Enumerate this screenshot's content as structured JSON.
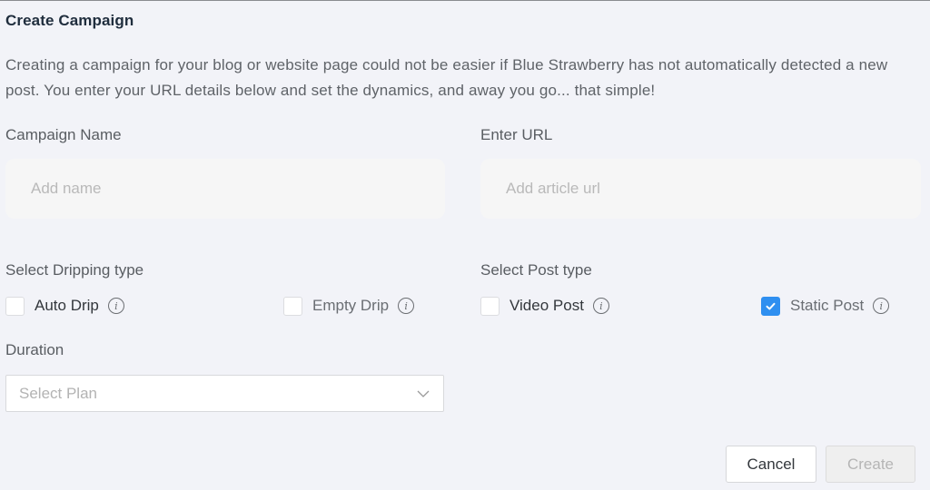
{
  "dialog": {
    "title": "Create Campaign",
    "description": "Creating a campaign for your blog or website page could not be easier if Blue Strawberry has not automatically detected a new post. You enter your URL details below and set the dynamics, and away you go... that simple!"
  },
  "campaign_name": {
    "label": "Campaign Name",
    "value": "",
    "placeholder": "Add name"
  },
  "url": {
    "label": "Enter URL",
    "value": "",
    "placeholder": "Add article url"
  },
  "dripping_type": {
    "label": "Select Dripping type",
    "options": [
      {
        "label": "Auto Drip",
        "checked": false,
        "icon": "info-icon"
      },
      {
        "label": "Empty Drip",
        "checked": false,
        "icon": "info-icon"
      }
    ]
  },
  "post_type": {
    "label": "Select Post type",
    "options": [
      {
        "label": "Video Post",
        "checked": false,
        "icon": "info-icon"
      },
      {
        "label": "Static Post",
        "checked": true,
        "icon": "info-icon"
      }
    ]
  },
  "duration": {
    "label": "Duration",
    "selected": "Select Plan",
    "icon": "chevron-down-icon"
  },
  "actions": {
    "cancel_label": "Cancel",
    "create_label": "Create",
    "create_disabled": true
  },
  "colors": {
    "accent": "#2f8ff0",
    "title": "#1f2d3d",
    "background": "#f2f3f8"
  }
}
